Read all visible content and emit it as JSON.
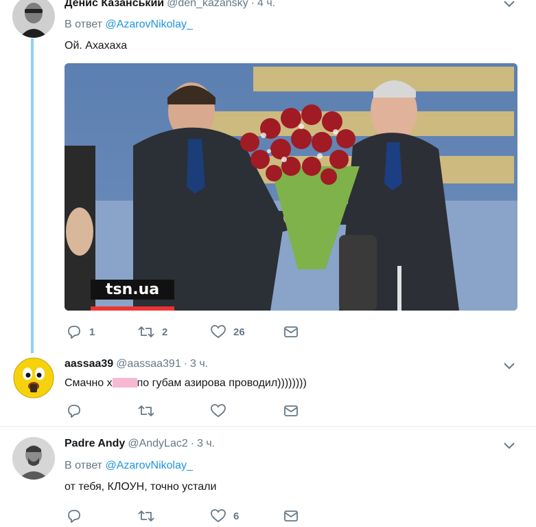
{
  "tweets": [
    {
      "name": "Денис Казанський",
      "handle": "@den_kazansky",
      "dot": "·",
      "time": "4 ч.",
      "reply_prefix": "В ответ",
      "reply_to": "@AzarovNikolay_",
      "text": "Ой. Ахахаха",
      "media_watermark": "tsn.ua",
      "actions": {
        "reply": "1",
        "retweet": "2",
        "like": "26"
      }
    },
    {
      "name": "aassaa39",
      "handle": "@aassaa391",
      "dot": "·",
      "time": "3 ч.",
      "text_before": "Смачно х",
      "text_after": "по губам азирова проводил))))))))",
      "actions": {
        "reply": "",
        "retweet": "",
        "like": ""
      }
    },
    {
      "name": "Padre Andy",
      "handle": "@AndyLac2",
      "dot": "·",
      "time": "3 ч.",
      "reply_prefix": "В ответ",
      "reply_to": "@AzarovNikolay_",
      "text": "от тебя, КЛОУН, точно устали",
      "actions": {
        "reply": "",
        "retweet": "",
        "like": "6"
      }
    }
  ],
  "colors": {
    "link": "#1b95e0",
    "muted": "#657786",
    "thread_line": "#8dd0f5"
  },
  "icons": [
    "reply-icon",
    "retweet-icon",
    "like-icon",
    "direct-message-icon",
    "chevron-down-icon"
  ]
}
